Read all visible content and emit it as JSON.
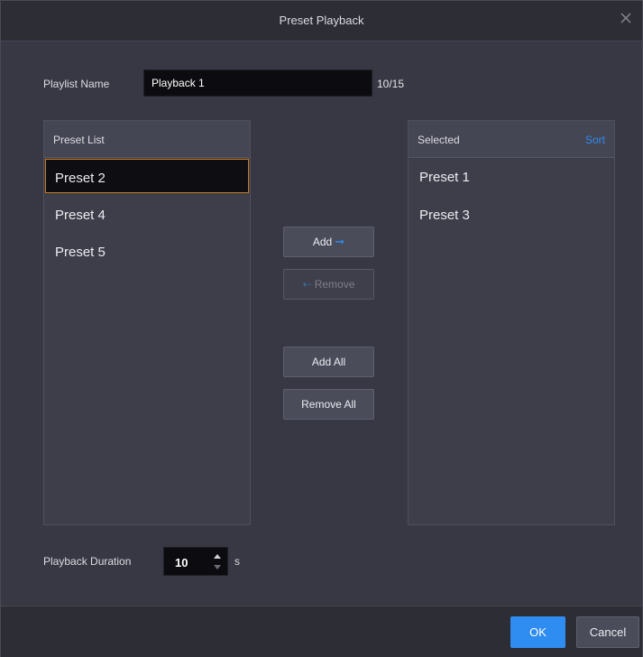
{
  "dialog": {
    "title": "Preset Playback"
  },
  "playlist": {
    "label": "Playlist Name",
    "value": "Playback 1",
    "count": "10/15"
  },
  "preset_list": {
    "title": "Preset List",
    "items": [
      "Preset 2",
      "Preset 4",
      "Preset 5"
    ],
    "selected_item": "Preset 2"
  },
  "selected_list": {
    "title": "Selected",
    "sort_label": "Sort",
    "items": [
      "Preset 1",
      "Preset 3"
    ]
  },
  "actions": {
    "add": "Add",
    "remove": "Remove",
    "add_all": "Add All",
    "remove_all": "Remove All"
  },
  "duration": {
    "label": "Playback Duration",
    "value": "10",
    "unit": "s"
  },
  "footer": {
    "ok": "OK",
    "cancel": "Cancel"
  },
  "colors": {
    "accent": "#2f8cf0",
    "selection_border": "#c97a1a",
    "background": "#373843"
  }
}
